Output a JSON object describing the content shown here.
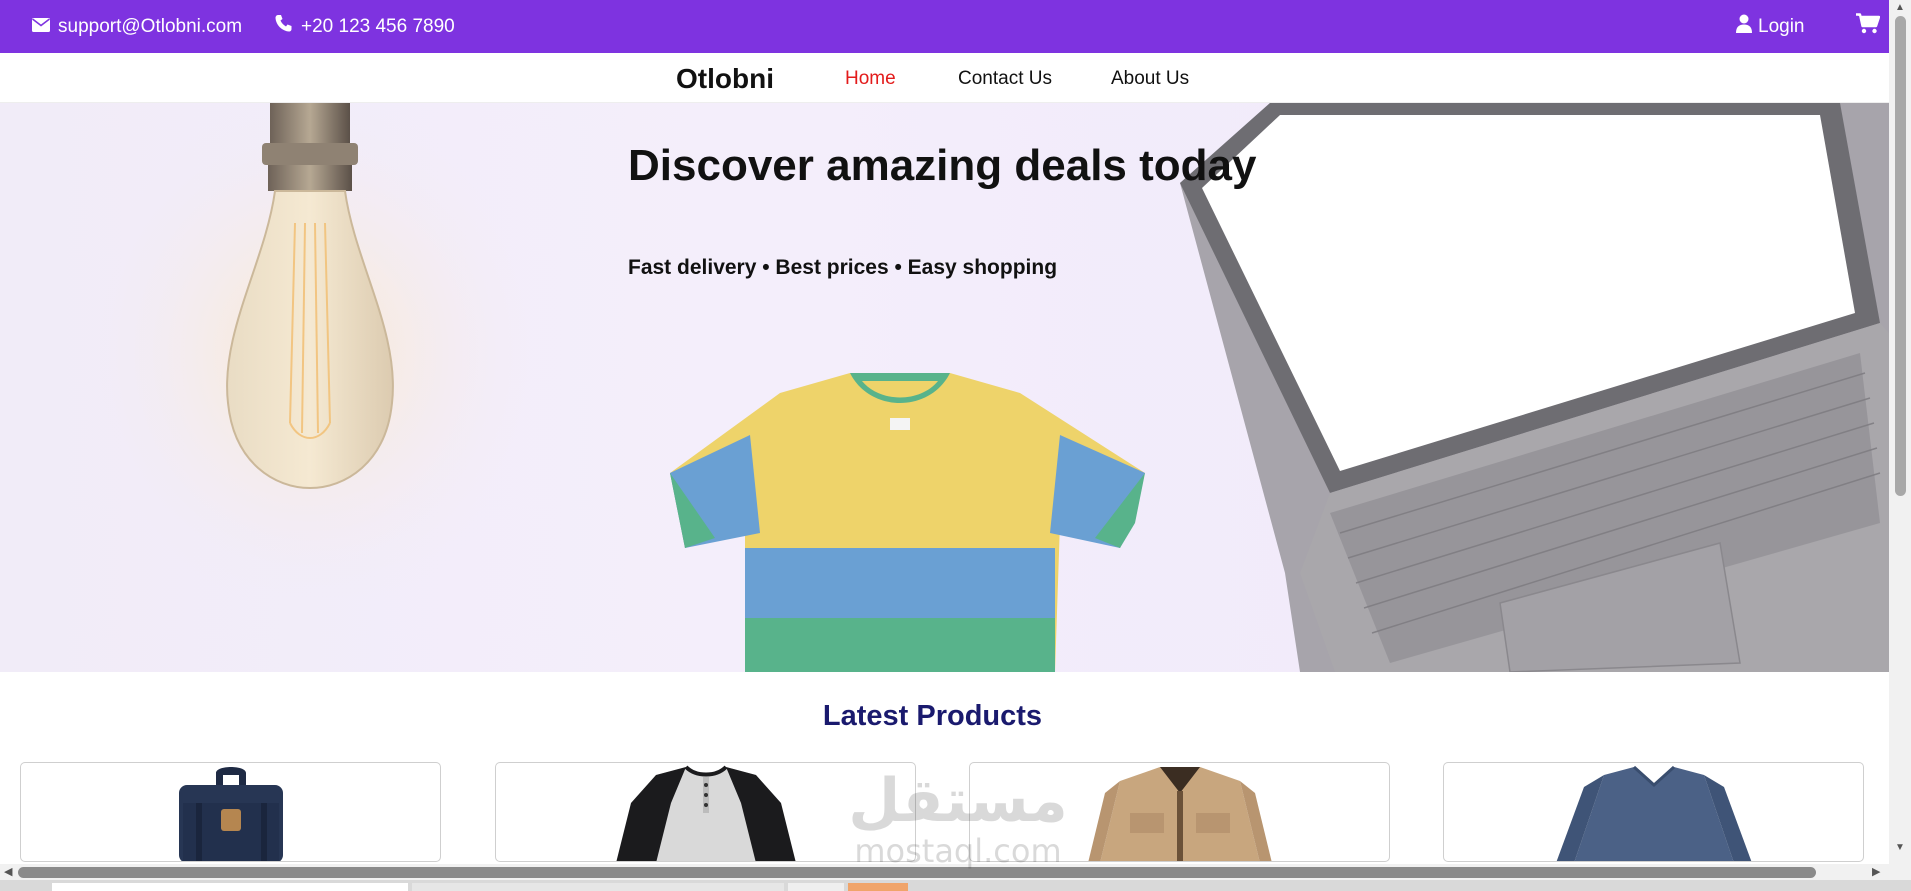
{
  "topbar": {
    "email": "support@Otlobni.com",
    "phone": "+20 123 456 7890",
    "login_label": "Login",
    "icons": [
      "envelope-icon",
      "phone-icon",
      "user-icon",
      "cart-icon"
    ],
    "background": "#7e33e0"
  },
  "navbar": {
    "brand": "Otlobni",
    "links": [
      {
        "label": "Home",
        "active": true
      },
      {
        "label": "Contact Us",
        "active": false
      },
      {
        "label": "About Us",
        "active": false
      }
    ],
    "active_color": "#e31b1b"
  },
  "hero": {
    "title": "Discover amazing deals today",
    "subtitle": "Fast delivery • Best prices • Easy shopping",
    "background": "#f1ecf8"
  },
  "latest": {
    "title": "Latest Products",
    "title_color": "#1a1a6e",
    "products": [
      {
        "image": "backpack-image"
      },
      {
        "image": "raglan-shirt-image"
      },
      {
        "image": "jacket-image"
      },
      {
        "image": "sweater-image"
      }
    ]
  },
  "watermark": {
    "arabic": "مستقل",
    "latin": "mostaql.com"
  }
}
